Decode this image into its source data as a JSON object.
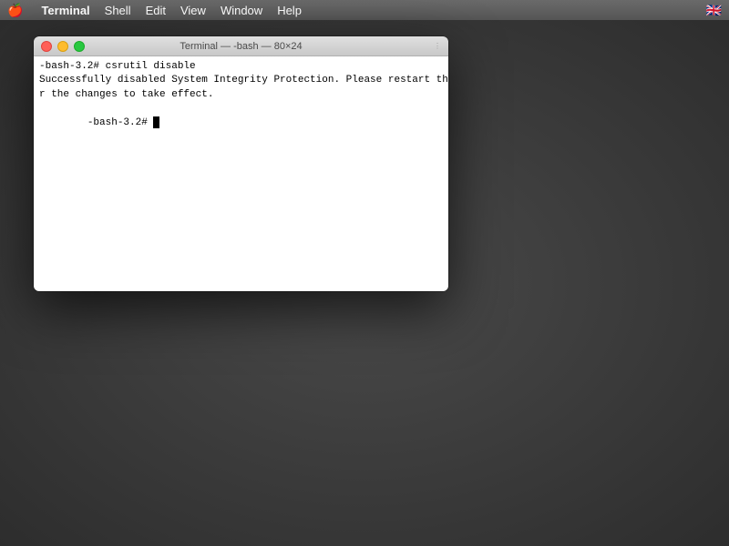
{
  "menubar": {
    "apple": "🍎",
    "items": [
      {
        "id": "terminal",
        "label": "Terminal",
        "bold": true
      },
      {
        "id": "shell",
        "label": "Shell"
      },
      {
        "id": "edit",
        "label": "Edit"
      },
      {
        "id": "view",
        "label": "View"
      },
      {
        "id": "window",
        "label": "Window"
      },
      {
        "id": "help",
        "label": "Help"
      }
    ],
    "flag": "🇬🇧"
  },
  "terminal_window": {
    "title": "Terminal — -bash — 80×24",
    "lines": [
      "-bash-3.2# csrutil disable",
      "Successfully disabled System Integrity Protection. Please restart the machine fo",
      "r the changes to take effect.",
      "-bash-3.2# "
    ]
  }
}
